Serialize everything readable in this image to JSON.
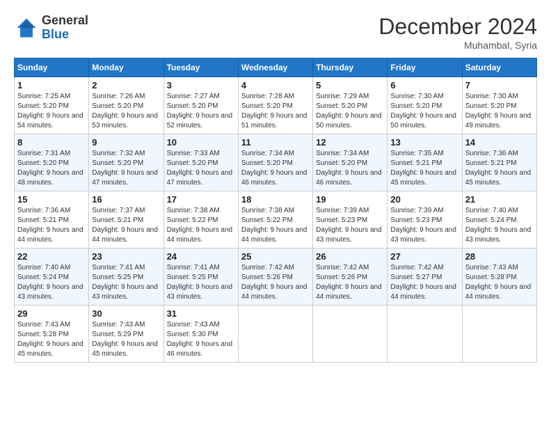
{
  "header": {
    "logo_general": "General",
    "logo_blue": "Blue",
    "month_title": "December 2024",
    "location": "Muhambal, Syria"
  },
  "weekdays": [
    "Sunday",
    "Monday",
    "Tuesday",
    "Wednesday",
    "Thursday",
    "Friday",
    "Saturday"
  ],
  "weeks": [
    [
      {
        "day": "1",
        "sunrise": "7:25 AM",
        "sunset": "5:20 PM",
        "daylight": "9 hours and 54 minutes."
      },
      {
        "day": "2",
        "sunrise": "7:26 AM",
        "sunset": "5:20 PM",
        "daylight": "9 hours and 53 minutes."
      },
      {
        "day": "3",
        "sunrise": "7:27 AM",
        "sunset": "5:20 PM",
        "daylight": "9 hours and 52 minutes."
      },
      {
        "day": "4",
        "sunrise": "7:28 AM",
        "sunset": "5:20 PM",
        "daylight": "9 hours and 51 minutes."
      },
      {
        "day": "5",
        "sunrise": "7:29 AM",
        "sunset": "5:20 PM",
        "daylight": "9 hours and 50 minutes."
      },
      {
        "day": "6",
        "sunrise": "7:30 AM",
        "sunset": "5:20 PM",
        "daylight": "9 hours and 50 minutes."
      },
      {
        "day": "7",
        "sunrise": "7:30 AM",
        "sunset": "5:20 PM",
        "daylight": "9 hours and 49 minutes."
      }
    ],
    [
      {
        "day": "8",
        "sunrise": "7:31 AM",
        "sunset": "5:20 PM",
        "daylight": "9 hours and 48 minutes."
      },
      {
        "day": "9",
        "sunrise": "7:32 AM",
        "sunset": "5:20 PM",
        "daylight": "9 hours and 47 minutes."
      },
      {
        "day": "10",
        "sunrise": "7:33 AM",
        "sunset": "5:20 PM",
        "daylight": "9 hours and 47 minutes."
      },
      {
        "day": "11",
        "sunrise": "7:34 AM",
        "sunset": "5:20 PM",
        "daylight": "9 hours and 46 minutes."
      },
      {
        "day": "12",
        "sunrise": "7:34 AM",
        "sunset": "5:20 PM",
        "daylight": "9 hours and 46 minutes."
      },
      {
        "day": "13",
        "sunrise": "7:35 AM",
        "sunset": "5:21 PM",
        "daylight": "9 hours and 45 minutes."
      },
      {
        "day": "14",
        "sunrise": "7:36 AM",
        "sunset": "5:21 PM",
        "daylight": "9 hours and 45 minutes."
      }
    ],
    [
      {
        "day": "15",
        "sunrise": "7:36 AM",
        "sunset": "5:21 PM",
        "daylight": "9 hours and 44 minutes."
      },
      {
        "day": "16",
        "sunrise": "7:37 AM",
        "sunset": "5:21 PM",
        "daylight": "9 hours and 44 minutes."
      },
      {
        "day": "17",
        "sunrise": "7:38 AM",
        "sunset": "5:22 PM",
        "daylight": "9 hours and 44 minutes."
      },
      {
        "day": "18",
        "sunrise": "7:38 AM",
        "sunset": "5:22 PM",
        "daylight": "9 hours and 44 minutes."
      },
      {
        "day": "19",
        "sunrise": "7:39 AM",
        "sunset": "5:23 PM",
        "daylight": "9 hours and 43 minutes."
      },
      {
        "day": "20",
        "sunrise": "7:39 AM",
        "sunset": "5:23 PM",
        "daylight": "9 hours and 43 minutes."
      },
      {
        "day": "21",
        "sunrise": "7:40 AM",
        "sunset": "5:24 PM",
        "daylight": "9 hours and 43 minutes."
      }
    ],
    [
      {
        "day": "22",
        "sunrise": "7:40 AM",
        "sunset": "5:24 PM",
        "daylight": "9 hours and 43 minutes."
      },
      {
        "day": "23",
        "sunrise": "7:41 AM",
        "sunset": "5:25 PM",
        "daylight": "9 hours and 43 minutes."
      },
      {
        "day": "24",
        "sunrise": "7:41 AM",
        "sunset": "5:25 PM",
        "daylight": "9 hours and 43 minutes."
      },
      {
        "day": "25",
        "sunrise": "7:42 AM",
        "sunset": "5:26 PM",
        "daylight": "9 hours and 44 minutes."
      },
      {
        "day": "26",
        "sunrise": "7:42 AM",
        "sunset": "5:26 PM",
        "daylight": "9 hours and 44 minutes."
      },
      {
        "day": "27",
        "sunrise": "7:42 AM",
        "sunset": "5:27 PM",
        "daylight": "9 hours and 44 minutes."
      },
      {
        "day": "28",
        "sunrise": "7:43 AM",
        "sunset": "5:28 PM",
        "daylight": "9 hours and 44 minutes."
      }
    ],
    [
      {
        "day": "29",
        "sunrise": "7:43 AM",
        "sunset": "5:28 PM",
        "daylight": "9 hours and 45 minutes."
      },
      {
        "day": "30",
        "sunrise": "7:43 AM",
        "sunset": "5:29 PM",
        "daylight": "9 hours and 45 minutes."
      },
      {
        "day": "31",
        "sunrise": "7:43 AM",
        "sunset": "5:30 PM",
        "daylight": "9 hours and 46 minutes."
      },
      null,
      null,
      null,
      null
    ]
  ]
}
